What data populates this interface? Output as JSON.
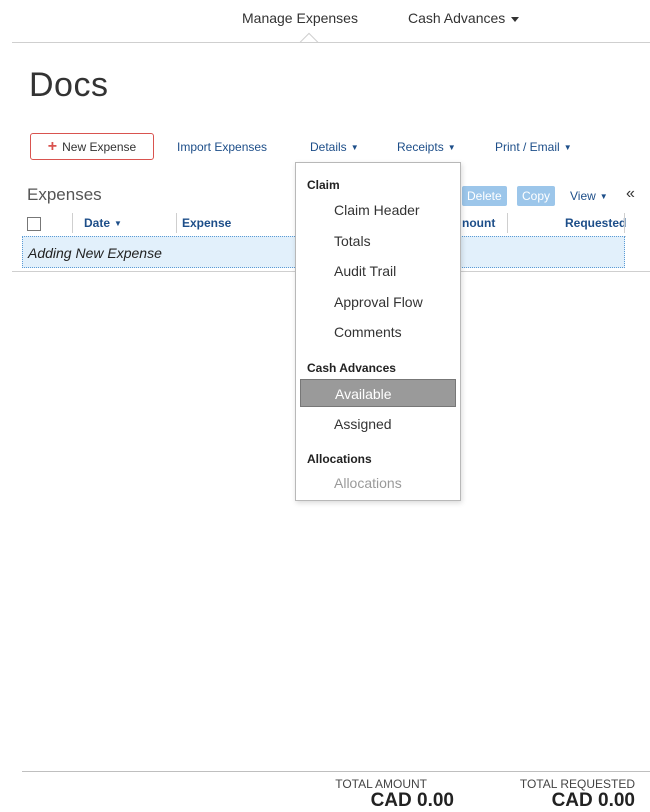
{
  "nav": {
    "manage_expenses": "Manage Expenses",
    "cash_advances": "Cash Advances"
  },
  "page": {
    "title": "Docs"
  },
  "toolbar": {
    "new_expense": "New Expense",
    "import_expenses": "Import Expenses",
    "details": "Details",
    "receipts": "Receipts",
    "print_email": "Print / Email"
  },
  "expenses": {
    "title": "Expenses",
    "delete": "Delete",
    "copy": "Copy",
    "view": "View",
    "columns": {
      "date": "Date",
      "expense": "Expense",
      "amount": "nount",
      "requested": "Requested"
    },
    "new_row": "Adding New Expense"
  },
  "details_menu": {
    "claim_heading": "Claim",
    "claim_items": [
      "Claim Header",
      "Totals",
      "Audit Trail",
      "Approval Flow",
      "Comments"
    ],
    "cash_heading": "Cash Advances",
    "cash_items": [
      "Available",
      "Assigned"
    ],
    "alloc_heading": "Allocations",
    "alloc_items": [
      "Allocations"
    ],
    "selected": "Available"
  },
  "totals": {
    "amount_label": "TOTAL AMOUNT",
    "amount_value": "CAD 0.00",
    "requested_label": "TOTAL REQUESTED",
    "requested_value": "CAD 0.00"
  },
  "colors": {
    "link": "#1d4e89",
    "new_expense_border": "#d9534f",
    "disabled_button": "#9cc6ea",
    "selected_menu": "#9a9a9a",
    "new_row_bg": "#e2f0fb"
  }
}
